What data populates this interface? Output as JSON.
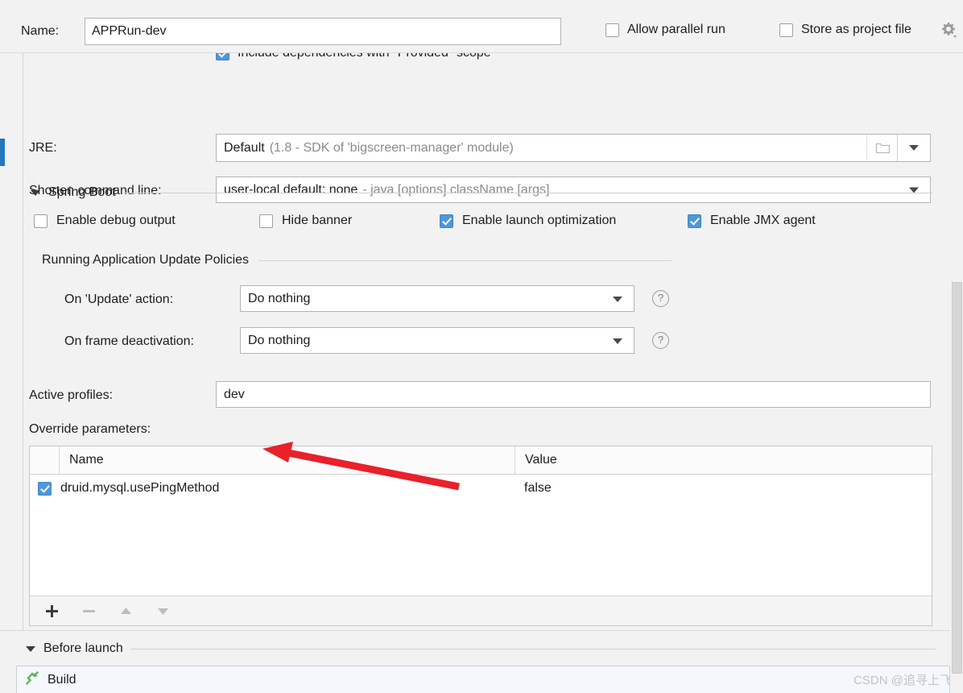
{
  "window": {
    "name_label": "Name:",
    "name_value": "APPRun-dev",
    "allow_parallel_run": "Allow parallel run",
    "store_as_project_file": "Store as project file",
    "gear_icon": "gear-icon"
  },
  "clipped_row": {
    "label": "Include dependencies with \"Provided\" scope",
    "checked": true
  },
  "jre": {
    "label": "JRE:",
    "value_strong": "Default",
    "value_dim": "(1.8 - SDK of 'bigscreen-manager' module)",
    "folder_icon": "folder-icon",
    "dropdown_icon": "chevron-down-icon"
  },
  "shorten_command_line": {
    "label": "Shorten command line:",
    "value_strong": "user-local default: none",
    "value_dim": "- java [options] className [args]",
    "dropdown_icon": "chevron-down-icon"
  },
  "spring_boot": {
    "title": "Spring Boot",
    "collapse_icon": "chevron-down-icon",
    "checkboxes": [
      {
        "label": "Enable debug output",
        "checked": false
      },
      {
        "label": "Hide banner",
        "checked": false
      },
      {
        "label": "Enable launch optimization",
        "checked": true
      },
      {
        "label": "Enable JMX agent",
        "checked": true
      }
    ],
    "policies": {
      "title": "Running Application Update Policies",
      "rows": [
        {
          "label": "On 'Update' action:",
          "value": "Do nothing",
          "help": "?"
        },
        {
          "label": "On frame deactivation:",
          "value": "Do nothing",
          "help": "?"
        }
      ]
    },
    "active_profiles": {
      "label": "Active profiles:",
      "value": "dev",
      "placeholder": ""
    },
    "override_parameters": {
      "label": "Override parameters:",
      "columns": [
        "Name",
        "Value"
      ],
      "rows": [
        {
          "checked": true,
          "name": "druid.mysql.usePingMethod",
          "value": "false"
        }
      ],
      "toolbar": [
        {
          "icon": "plus-icon",
          "label": "+",
          "enabled": true
        },
        {
          "icon": "minus-icon",
          "label": "−",
          "enabled": false
        },
        {
          "icon": "arrow-up-icon",
          "label": "▲",
          "enabled": false
        },
        {
          "icon": "arrow-down-icon",
          "label": "▼",
          "enabled": false
        }
      ]
    }
  },
  "before_launch": {
    "title": "Before launch",
    "collapse_icon": "chevron-down-icon",
    "items": [
      {
        "icon": "hammer-icon",
        "label": "Build"
      }
    ]
  },
  "watermark": "CSDN @追寻上飞",
  "colors": {
    "accent_blue": "#4f97d8",
    "selection_blue": "#2675bf",
    "annotation_red": "#e8212a",
    "panel_bg": "#f2f2f2",
    "field_bg": "#ffffff",
    "dim_text": "#8b8b8b",
    "build_row_bg": "#f4f8fd",
    "hammer_green": "#62b15c"
  }
}
